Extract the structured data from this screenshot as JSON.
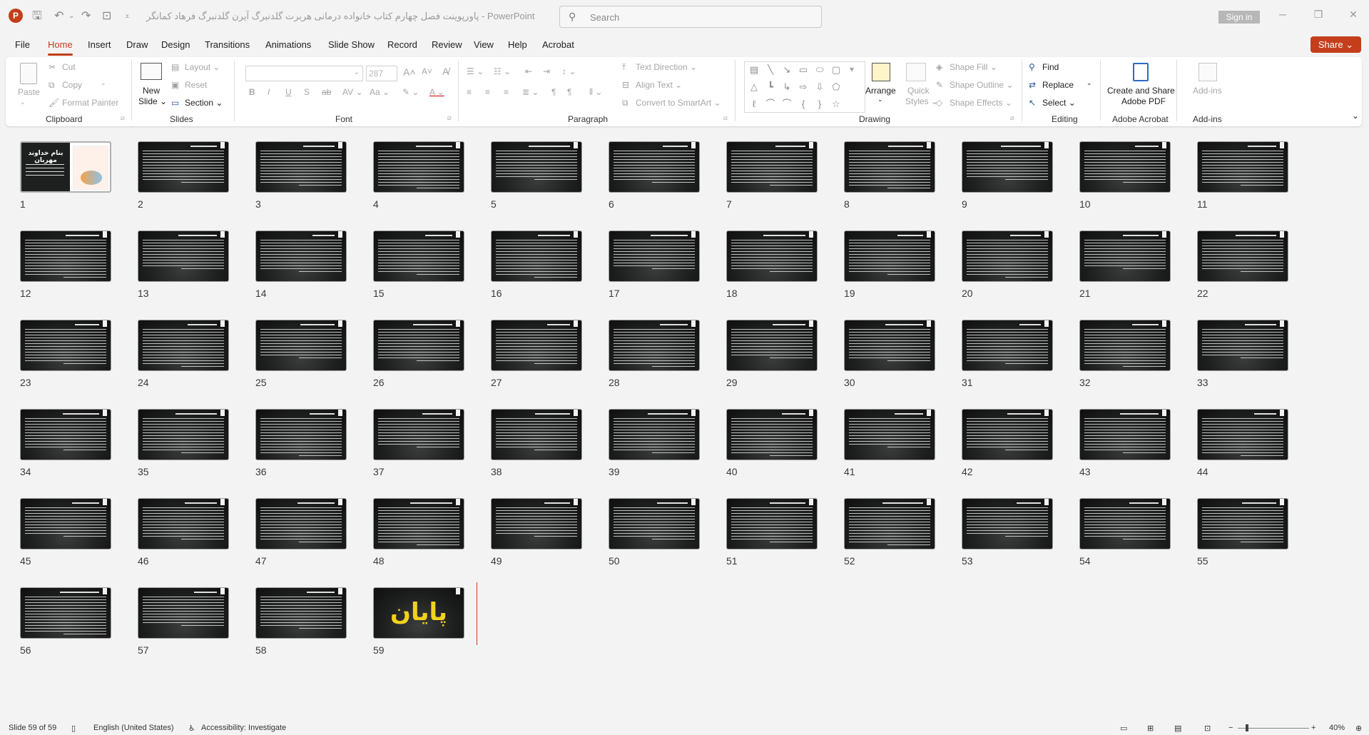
{
  "app": {
    "doc_title": "پاورپوینت فصل چهارم کتاب خانواده درمانی هربرت گلدنبرگ آیرن گلدنبرگ فرهاد کمانگر",
    "app_name": "PowerPoint",
    "separator": " - ",
    "logo_letter": "P",
    "search_placeholder": "Search",
    "sign_in": "Sign in",
    "share": "Share"
  },
  "tabs": [
    "File",
    "Home",
    "Insert",
    "Draw",
    "Design",
    "Transitions",
    "Animations",
    "Slide Show",
    "Record",
    "Review",
    "View",
    "Help",
    "Acrobat"
  ],
  "active_tab": "Home",
  "ribbon": {
    "clipboard": {
      "paste": "Paste",
      "cut": "Cut",
      "copy": "Copy",
      "format_painter": "Format Painter",
      "label": "Clipboard"
    },
    "slides": {
      "new_slide": "New",
      "new_slide_2": "Slide",
      "layout": "Layout",
      "reset": "Reset",
      "section": "Section",
      "label": "Slides"
    },
    "font": {
      "size": "287",
      "label": "Font"
    },
    "paragraph": {
      "text_direction": "Text Direction",
      "align_text": "Align Text",
      "convert_smartart": "Convert to SmartArt",
      "label": "Paragraph"
    },
    "drawing": {
      "arrange": "Arrange",
      "quick": "Quick",
      "styles": "Styles",
      "shape_fill": "Shape Fill",
      "shape_outline": "Shape Outline",
      "shape_effects": "Shape Effects",
      "label": "Drawing"
    },
    "editing": {
      "find": "Find",
      "replace": "Replace",
      "select": "Select",
      "label": "Editing"
    },
    "acrobat": {
      "line1": "Create and Share",
      "line2": "Adobe PDF",
      "label": "Adobe Acrobat"
    },
    "addins": {
      "button": "Add-ins",
      "label": "Add-ins"
    }
  },
  "slides": {
    "total": 59,
    "first_slide_title": "بنام خداوند مهربان",
    "last_slide_text": "پایان"
  },
  "status": {
    "slide_info": "Slide 59 of 59",
    "language": "English (United States)",
    "accessibility": "Accessibility: Investigate",
    "zoom": "40%"
  }
}
